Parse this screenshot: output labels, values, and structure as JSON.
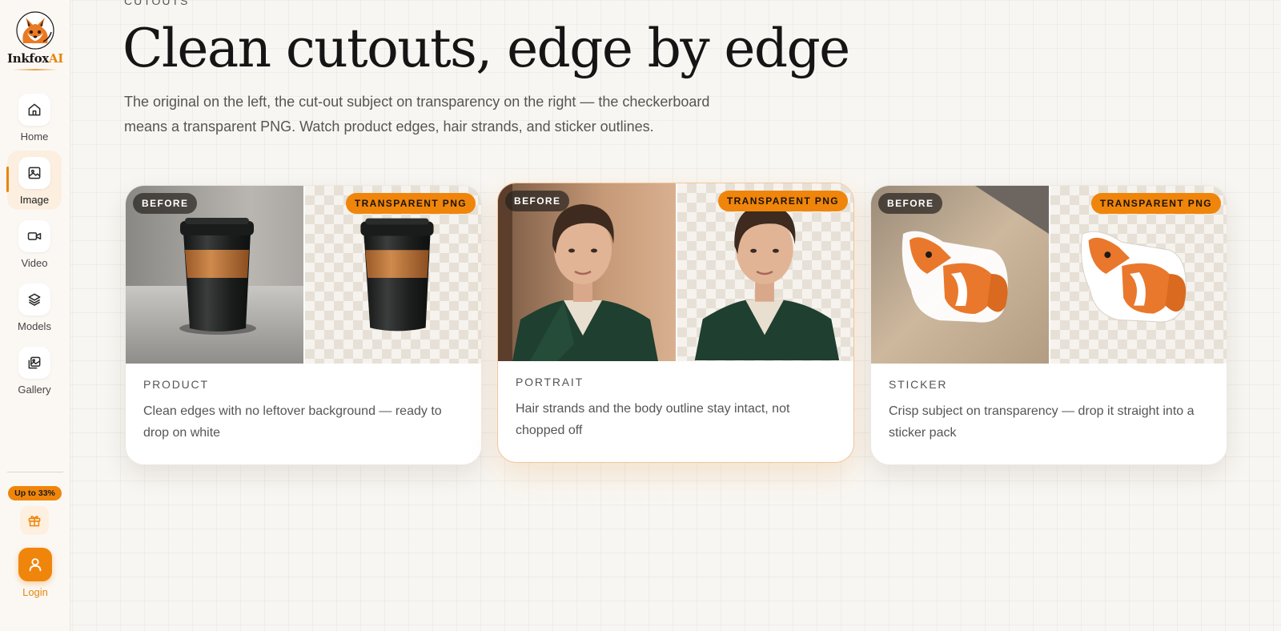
{
  "brand": {
    "name_main": "Inkfox",
    "name_accent": "AI"
  },
  "sidebar": {
    "items": [
      {
        "label": "Home",
        "icon": "home-icon"
      },
      {
        "label": "Image",
        "icon": "image-icon",
        "active": true
      },
      {
        "label": "Video",
        "icon": "video-icon"
      },
      {
        "label": "Models",
        "icon": "layers-icon"
      },
      {
        "label": "Gallery",
        "icon": "gallery-icon"
      }
    ],
    "promo_badge": "Up to 33%",
    "gift_icon": "gift-icon",
    "login_label": "Login",
    "login_icon": "user-icon"
  },
  "section": {
    "eyebrow": "CUTOUTS",
    "title": "Clean cutouts, edge by edge",
    "description": "The original on the left, the cut-out subject on transparency on the right — the checkerboard means a transparent PNG. Watch product edges, hair strands, and sticker outlines."
  },
  "cards": [
    {
      "before_tag": "BEFORE",
      "after_tag": "TRANSPARENT PNG",
      "kicker": "PRODUCT",
      "description": "Clean edges with no leftover background — ready to drop on white"
    },
    {
      "before_tag": "BEFORE",
      "after_tag": "TRANSPARENT PNG",
      "kicker": "PORTRAIT",
      "description": "Hair strands and the body outline stay intact, not chopped off"
    },
    {
      "before_tag": "BEFORE",
      "after_tag": "TRANSPARENT PNG",
      "kicker": "STICKER",
      "description": "Crisp subject on transparency — drop it straight into a sticker pack"
    }
  ],
  "colors": {
    "accent": "#f0850b",
    "background": "#f8f6f2",
    "sidebar_bg": "#fbf8f4",
    "checker": "#e6e0d6"
  }
}
